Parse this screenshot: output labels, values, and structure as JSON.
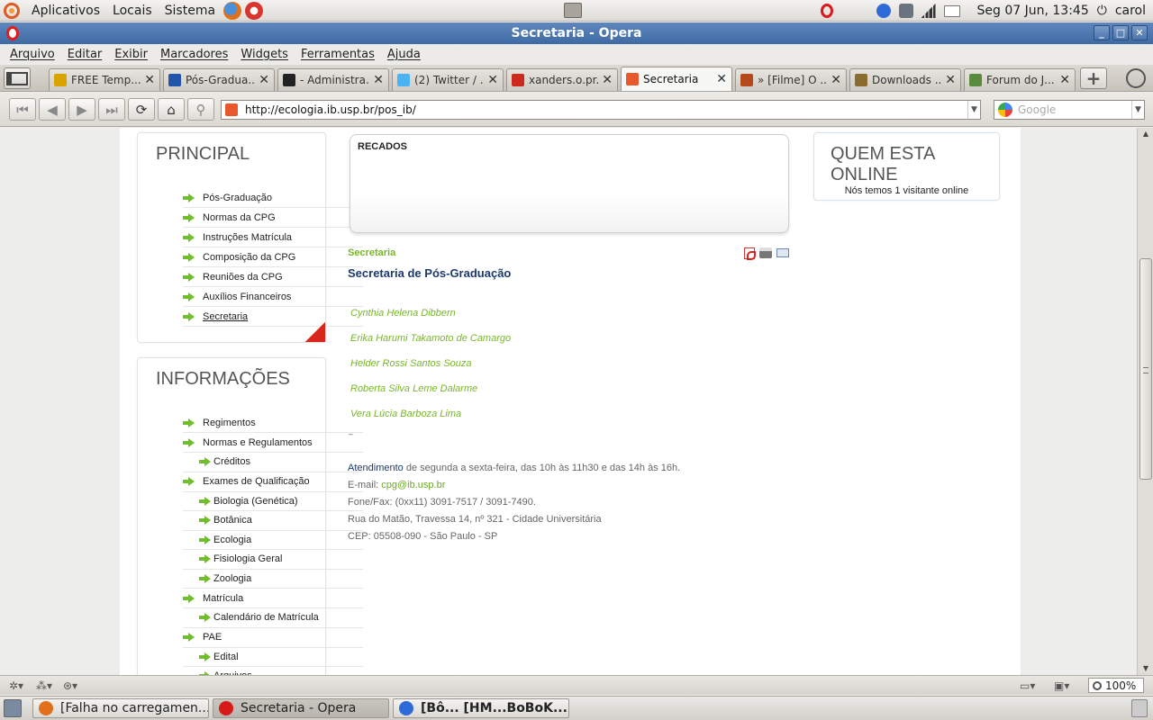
{
  "top_panel": {
    "menus": [
      "Aplicativos",
      "Locais",
      "Sistema"
    ],
    "clock": "Seg 07 Jun, 13:45",
    "user": "carol"
  },
  "window": {
    "title": "Secretaria - Opera"
  },
  "menubar": [
    "Arquivo",
    "Editar",
    "Exibir",
    "Marcadores",
    "Widgets",
    "Ferramentas",
    "Ajuda"
  ],
  "tabs": [
    {
      "label": "FREE Temp...",
      "icon_color": "#d9a400"
    },
    {
      "label": "Pós-Gradua...",
      "icon_color": "#2255aa"
    },
    {
      "label": "- Administra...",
      "icon_color": "#222222"
    },
    {
      "label": "(2) Twitter / ...",
      "icon_color": "#4ab3f4"
    },
    {
      "label": "xanders.o.pr...",
      "icon_color": "#cc2a1f"
    },
    {
      "label": "Secretaria",
      "icon_color": "#e8582c",
      "active": true
    },
    {
      "label": "» [Filme] O ...",
      "icon_color": "#b5491b"
    },
    {
      "label": "Downloads ...",
      "icon_color": "#8a6d2e"
    },
    {
      "label": "Forum do J...",
      "icon_color": "#5a8a3c"
    }
  ],
  "address": {
    "url": "http://ecologia.ib.usp.br/pos_ib/",
    "search_placeholder": "Google"
  },
  "sidebar": {
    "principal": {
      "title": "PRINCIPAL",
      "items": [
        "Pós-Graduação",
        "Normas da CPG",
        "Instruções Matrícula",
        "Composição da CPG",
        "Reuniões da CPG",
        "Auxílios Financeiros",
        "Secretaria"
      ]
    },
    "informacoes": {
      "title": "INFORMAÇÕES",
      "items": [
        {
          "label": "Regimentos",
          "sub": false
        },
        {
          "label": "Normas e Regulamentos",
          "sub": false
        },
        {
          "label": "Créditos",
          "sub": true
        },
        {
          "label": "Exames de Qualificação",
          "sub": false
        },
        {
          "label": "Biologia (Genética)",
          "sub": true
        },
        {
          "label": "Botânica",
          "sub": true
        },
        {
          "label": "Ecologia",
          "sub": true
        },
        {
          "label": "Fisiologia Geral",
          "sub": true
        },
        {
          "label": "Zoologia",
          "sub": true
        },
        {
          "label": "Matrícula",
          "sub": false
        },
        {
          "label": "Calendário de Matrícula",
          "sub": true
        },
        {
          "label": "PAE",
          "sub": false
        },
        {
          "label": "Edital",
          "sub": true
        },
        {
          "label": "Arquivos",
          "sub": true
        }
      ]
    }
  },
  "main": {
    "recados_title": "RECADOS",
    "breadcrumb": "Secretaria",
    "article_title": "Secretaria de Pós-Graduação",
    "staff": [
      "Cynthia Helena Dibbern",
      "Erika Harumi Takamoto de Camargo",
      "Helder Rossi Santos Souza",
      "Roberta Silva Leme Dalarme",
      "Vera Lúcia Barboza Lima"
    ],
    "underscore": "_",
    "contact": {
      "atendimento_label": "Atendimento",
      "atendimento_text": " de segunda a sexta-feira, das 10h às 11h30 e das 14h às 16h.",
      "email_label": "E-mail: ",
      "email": "cpg@ib.usp.br",
      "phone": "Fone/Fax: (0xx11) 3091-7517 / 3091-7490.",
      "address": "Rua do Matão, Travessa 14, nº 321 - Cidade Universitária",
      "cep": "CEP: 05508-090 - São Paulo - SP"
    }
  },
  "online": {
    "title": "QUEM ESTA ONLINE",
    "text": "Nós temos 1 visitante online"
  },
  "statusbar": {
    "zoom": "100%"
  },
  "taskbar": [
    {
      "label": "[Falha no carregamen...",
      "icon_color": "#e0701a",
      "bold": false
    },
    {
      "label": "Secretaria - Opera",
      "icon_color": "#d71a1a",
      "bold": false,
      "active": true
    },
    {
      "label": "[Bô... [HM...BoBoK...",
      "icon_color": "#2f6bd8",
      "bold": true
    }
  ]
}
